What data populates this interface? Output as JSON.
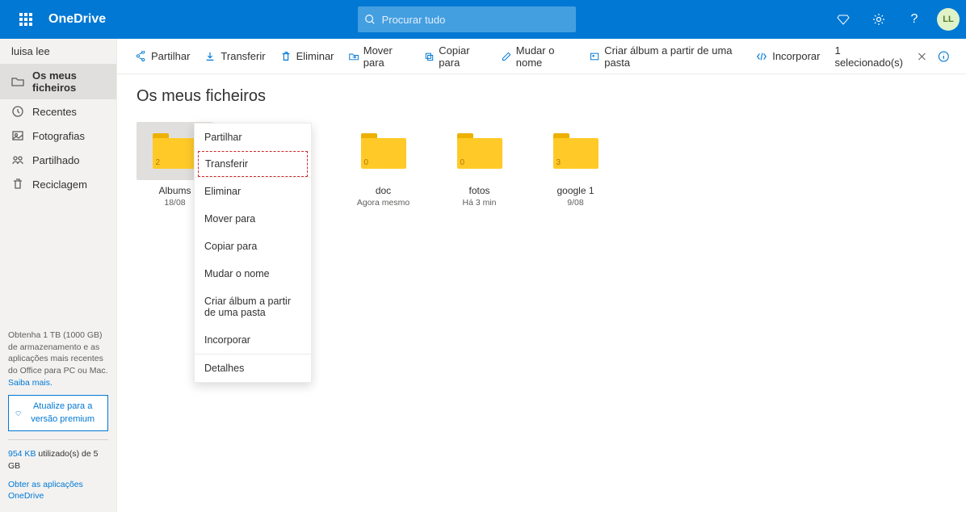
{
  "header": {
    "brand": "OneDrive",
    "search_placeholder": "Procurar tudo",
    "avatar_initials": "LL"
  },
  "user_label": "luisa lee",
  "sidebar": {
    "items": [
      {
        "label": "Os meus ficheiros",
        "active": true
      },
      {
        "label": "Recentes"
      },
      {
        "label": "Fotografias"
      },
      {
        "label": "Partilhado"
      },
      {
        "label": "Reciclagem"
      }
    ],
    "footer_promo": "Obtenha 1 TB (1000 GB) de armazenamento e as aplicações mais recentes do Office para PC ou Mac.",
    "learn_more": "Saiba mais.",
    "premium_button": "Atualize para a versão premium",
    "storage_used": "954 KB",
    "storage_total": "5 GB",
    "storage_text_prefix": " utilizado(s) de ",
    "get_apps": "Obter as aplicações OneDrive"
  },
  "commandbar": {
    "items": [
      "Partilhar",
      "Transferir",
      "Eliminar",
      "Mover para",
      "Copiar para",
      "Mudar o nome",
      "Criar álbum a partir de uma pasta",
      "Incorporar"
    ],
    "selection_text": "1 selecionado(s)"
  },
  "page_title": "Os meus ficheiros",
  "folders": [
    {
      "name": "Albums",
      "date": "18/08",
      "count": "2",
      "selected": true
    },
    {
      "name": "",
      "date": "",
      "count": "",
      "selected": false,
      "hidden_label": true
    },
    {
      "name": "doc",
      "date": "Agora mesmo",
      "count": "0"
    },
    {
      "name": "fotos",
      "date": "Há 3 min",
      "count": "0"
    },
    {
      "name": "google 1",
      "date": "9/08",
      "count": "3"
    }
  ],
  "context_menu": {
    "items": [
      "Partilhar",
      "Transferir",
      "Eliminar",
      "Mover para",
      "Copiar para",
      "Mudar o nome",
      "Criar álbum a partir de uma pasta",
      "Incorporar",
      "Detalhes"
    ],
    "highlighted_index": 1
  }
}
